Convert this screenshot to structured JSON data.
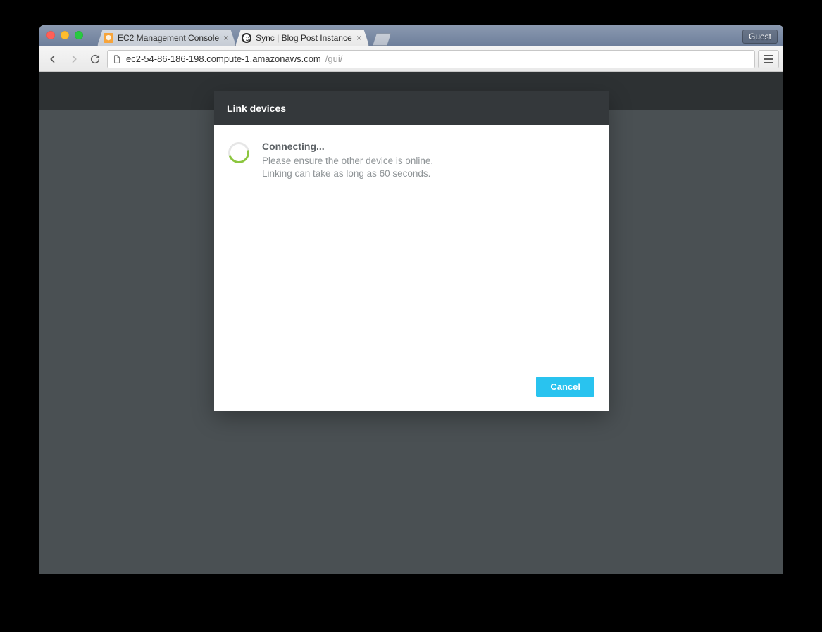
{
  "chrome": {
    "guest_label": "Guest",
    "tabs": [
      {
        "title": "EC2 Management Console",
        "active": false
      },
      {
        "title": "Sync | Blog Post Instance",
        "active": true
      }
    ],
    "url_host": "ec2-54-86-186-198.compute-1.amazonaws.com",
    "url_path": "/gui/"
  },
  "modal": {
    "title": "Link devices",
    "status_title": "Connecting...",
    "hint_line1": "Please ensure the other device is online.",
    "hint_line2": "Linking can take as long as 60 seconds.",
    "cancel_label": "Cancel"
  }
}
